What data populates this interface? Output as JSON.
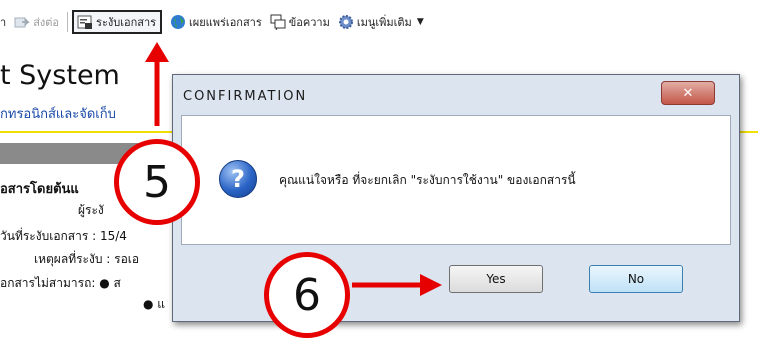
{
  "toolbar": {
    "item1_label": "า",
    "forward_label": "ส่งต่อ",
    "suspend_label": "ระงับเอกสาร",
    "publish_label": "เผยแพร่เอกสาร",
    "message_label": "ข้อความ",
    "more_menu_label": "เมนูเพิ่มเติม"
  },
  "background": {
    "title": "t System",
    "subtitle": "กทรอนิกส์และจัดเก็บ",
    "line_heading": "อสารโดยต้นแ",
    "line_by": "ผู้ระงั",
    "line_date": "วันที่ระงับเอกสาร : 15/4",
    "line_reason": "เหตุผลที่ระงับ : รอเอ",
    "line_cannot": "อกสารไม่สามารถ: ●  ส",
    "line_bullet2": "●  แ"
  },
  "dialog": {
    "title": "CONFIRMATION",
    "message": "คุณแน่ใจหรือ ที่จะยกเลิก \"ระงับการใช้งาน\" ของเอกสารนี้",
    "yes_label": "Yes",
    "no_label": "No",
    "close_glyph": "✕",
    "question_glyph": "?"
  },
  "annotations": {
    "step5": "5",
    "step6": "6",
    "color": "#e60000"
  },
  "icons": [
    "forward-icon",
    "document-suspend-icon",
    "globe-icon",
    "message-icon",
    "gear-icon",
    "question-icon",
    "close-icon"
  ]
}
